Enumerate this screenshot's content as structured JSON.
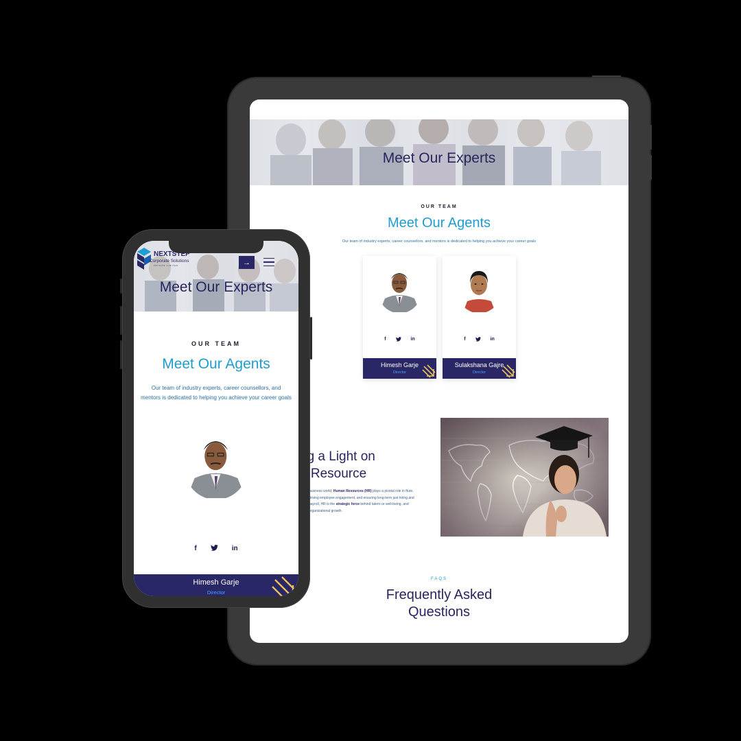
{
  "tablet": {
    "hero_title": "Meet Our Experts",
    "team": {
      "eyebrow": "OUR TEAM",
      "title": "Meet Our Agents",
      "description": "Our team of industry experts, career counsellors, and mentors is dedicated to helping you achieve your career goals"
    },
    "agents": [
      {
        "name": "Himesh Garje",
        "role": "Director",
        "socials": [
          "f",
          "t",
          "in"
        ]
      },
      {
        "name": "Sulakshana Gajre",
        "role": "Director",
        "socials": [
          "f",
          "t",
          "in"
        ]
      }
    ],
    "hr_section": {
      "title": "ng a Light on\nn Resource",
      "text_prefix": "business world,",
      "text_bold1": "Human Resources (HR)",
      "text_mid1": "plays a pivotal role in fture, driving employee engagement, and ensuring long-term just hiring and payroll, HR is the",
      "text_bold2": "strategic force",
      "text_mid2": "behind talent ce well-being, and organizational growth."
    },
    "faq": {
      "eyebrow": "FAQS",
      "title": "Frequently Asked\nQuestions"
    }
  },
  "phone": {
    "logo": {
      "brand": "NEXTSTEP",
      "sub": "Corporate Solutions",
      "tag": "PRIVATE LIMITED"
    },
    "hero_title": "Meet Our Experts",
    "team": {
      "eyebrow": "OUR TEAM",
      "title": "Meet Our Agents",
      "description_line1": "Our team of industry experts, career counsellors, and",
      "description_line2": "mentors is dedicated to helping you achieve your career goals"
    },
    "agent": {
      "name": "Himesh Garje",
      "role": "Director",
      "socials": [
        "f",
        "t",
        "in"
      ]
    }
  },
  "colors": {
    "navy": "#2a2766",
    "accent_blue": "#1f9dd0",
    "gold": "#e8c15a"
  }
}
